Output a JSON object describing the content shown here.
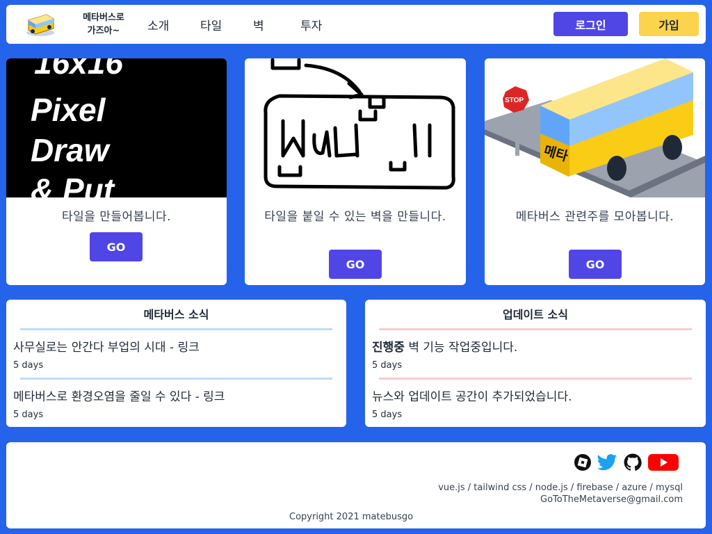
{
  "header": {
    "brand_line1": "메타버스로",
    "brand_line2": "가즈아~",
    "nav": [
      "소개",
      "타일",
      "벽",
      "투자"
    ],
    "login_label": "로그인",
    "join_label": "가입"
  },
  "cards": [
    {
      "image_text": [
        "16x16",
        "Pixel",
        "Draw",
        "& Put"
      ],
      "text": "타일을 만들어봅니다.",
      "button": "GO"
    },
    {
      "image_text": "Wall",
      "text": "타일을 붙일 수 있는 벽을 만들니다.",
      "button": "GO"
    },
    {
      "image_text": [
        "STOP",
        "메타"
      ],
      "text": "메타버스 관련주를 모아봅니다.",
      "button": "GO"
    }
  ],
  "metaverse_news": {
    "title": "메타버스 소식",
    "items": [
      {
        "text": "사무실로는 안간다 부업의 시대 - 링크",
        "time": "5 days"
      },
      {
        "text": "메타버스로 환경오염을 줄일 수 있다 - 링크",
        "time": "5 days"
      }
    ]
  },
  "update_news": {
    "title": "업데이트 소식",
    "items": [
      {
        "bold": "진행중",
        "text": " 벽 기능 작업중입니다.",
        "time": "5 days"
      },
      {
        "text": "뉴스와 업데이트 공간이 추가되었습니다.",
        "time": "5 days"
      }
    ]
  },
  "footer": {
    "social_icons": [
      "roblox-icon",
      "twitter-icon",
      "github-icon",
      "youtube-icon"
    ],
    "stack": "vue.js / tailwind css / node.js / firebase / azure / mysql",
    "email": "GoToTheMetaverse@gmail.com",
    "copyright": "Copyright 2021 matebusgo"
  },
  "colors": {
    "background": "#2563eb",
    "primary": "#4f46e5",
    "accent": "#fcd34d",
    "metaverse_divider": "#bfdbfe",
    "update_divider": "#fecaca"
  }
}
